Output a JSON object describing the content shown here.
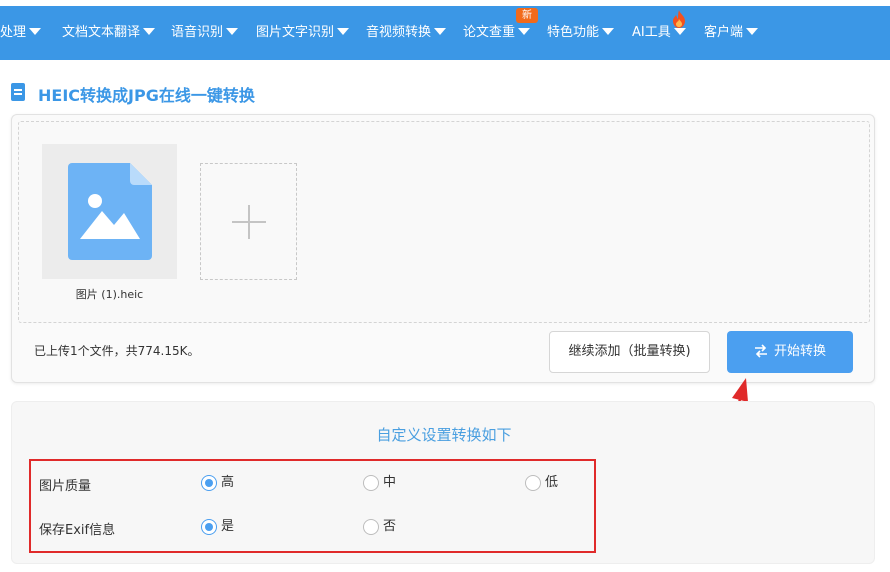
{
  "nav": {
    "items": [
      {
        "label": "处理"
      },
      {
        "label": "文档文本翻译"
      },
      {
        "label": "语音识别"
      },
      {
        "label": "图片文字识别"
      },
      {
        "label": "音视频转换"
      },
      {
        "label": "论文查重"
      },
      {
        "label": "特色功能"
      },
      {
        "label": "AI工具"
      },
      {
        "label": "客户端"
      }
    ],
    "new_badge": "新",
    "hot_icon": "flame-icon",
    "bg_color": "#3b97e6"
  },
  "page": {
    "title": "HEIC转换成JPG在线一键转换",
    "title_icon": "document-icon"
  },
  "upload": {
    "file_name": "图片 (1).heic",
    "file_icon": "image-file-icon",
    "add_icon": "plus-icon",
    "status": "已上传1个文件，共774.15K。",
    "continue_button": "继续添加（批量转换)",
    "start_button": "开始转换",
    "start_icon": "swap-arrows-icon"
  },
  "settings": {
    "title": "自定义设置转换如下",
    "quality": {
      "label": "图片质量",
      "options": [
        "高",
        "中",
        "低"
      ],
      "selected": "高"
    },
    "exif": {
      "label": "保存Exif信息",
      "options": [
        "是",
        "否"
      ],
      "selected": "是"
    }
  },
  "colors": {
    "accent": "#4b9ff0",
    "highlight_box": "#e02a2a",
    "annotation_arrow": "#e02a2a"
  }
}
